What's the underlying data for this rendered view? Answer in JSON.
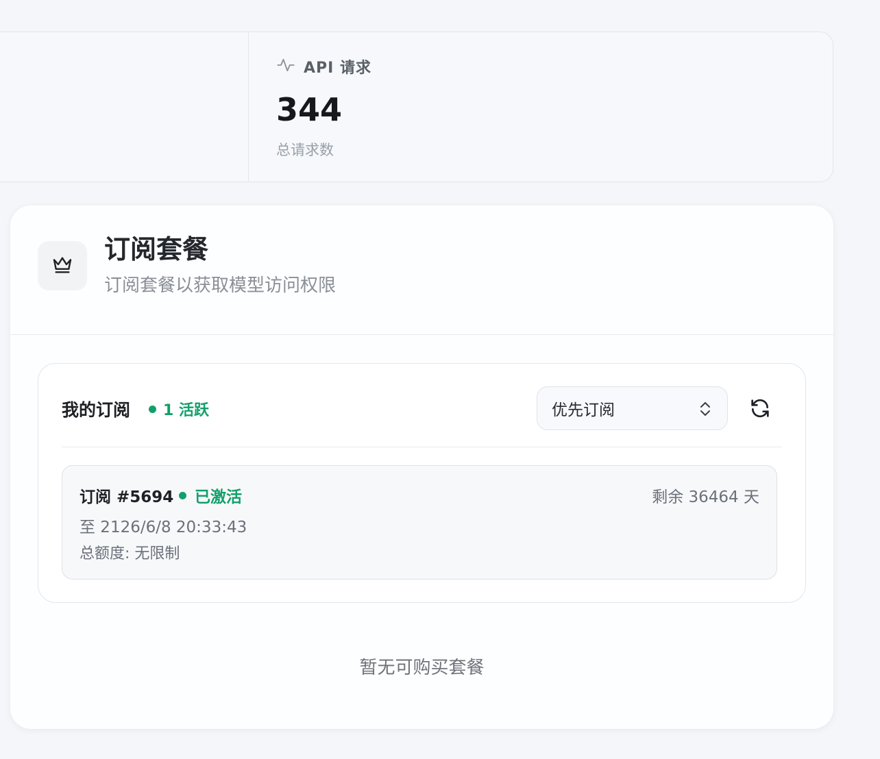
{
  "stats": {
    "api_requests": {
      "icon": "activity-icon",
      "label": "API 请求",
      "value": "344",
      "sublabel": "总请求数"
    }
  },
  "subscription_card": {
    "icon": "crown-icon",
    "title": "订阅套餐",
    "subtitle": "订阅套餐以获取模型访问权限",
    "my_subscriptions": {
      "title": "我的订阅",
      "active_count_label": "1 活跃",
      "priority_select": {
        "selected": "优先订阅",
        "icon": "chevron-up-down-icon"
      },
      "refresh_icon": "refresh-icon",
      "items": [
        {
          "id_label": "订阅 #5694",
          "status": "已激活",
          "remaining": "剩余 36464 天",
          "until": "至 2126/6/8 20:33:43",
          "quota": "总额度: 无限制"
        }
      ]
    },
    "empty_plans_text": "暂无可购买套餐"
  },
  "colors": {
    "accent_green": "#12a06a",
    "background": "#f4f6f9",
    "card": "#fdfeff"
  }
}
